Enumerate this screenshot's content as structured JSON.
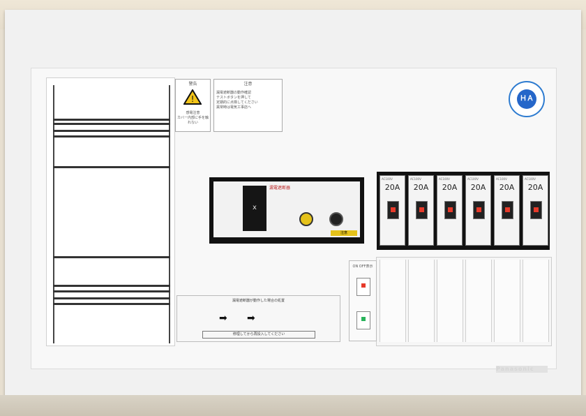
{
  "warning_label": {
    "heading": "警告",
    "line1": "感電注意",
    "line2": "カバー内部に手を触れない"
  },
  "caution_label": {
    "heading": "注意",
    "lines": [
      "漏電遮断器の動作確認",
      "テストボタンを押して",
      "定期的に点検してください",
      "異常時は電気工事店へ"
    ]
  },
  "logo": {
    "text": "ＨＡ"
  },
  "main_breaker": {
    "title": "漏電遮断器",
    "lever_symbol": "ⅹ",
    "test_button_color": "#e5c21a",
    "reset_button_color": "#222222",
    "badge": "注意"
  },
  "branch_breakers": [
    {
      "rating": "20A",
      "cap": "AC100V"
    },
    {
      "rating": "20A",
      "cap": "AC100V"
    },
    {
      "rating": "20A",
      "cap": "AC100V"
    },
    {
      "rating": "20A",
      "cap": "AC100V"
    },
    {
      "rating": "20A",
      "cap": "AC100V"
    },
    {
      "rating": "20A",
      "cap": "AC100V"
    }
  ],
  "indicator": {
    "label": "ON OFF表示"
  },
  "bottom_label": {
    "title": "漏電遮断器が動作した場合の処置",
    "note": "修理してから再投入してください"
  },
  "brand": {
    "text": "Panasonic"
  },
  "colors": {
    "panel": "#f1f1f1",
    "cover_beige": "#e7dfd0",
    "accent_red": "#e63a2a",
    "accent_green": "#29b35a",
    "logo_blue": "#2566c9"
  }
}
